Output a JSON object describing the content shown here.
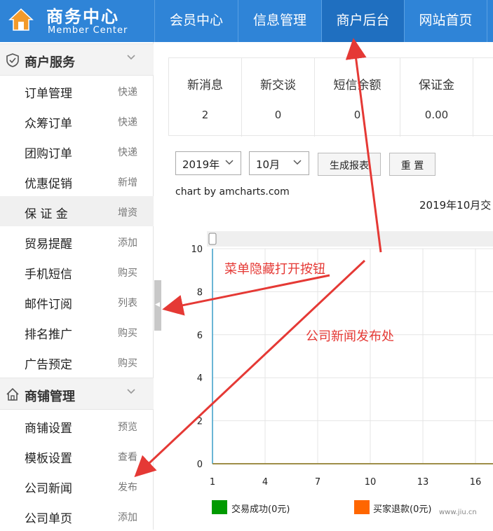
{
  "header": {
    "title": "商务中心",
    "subtitle": "Member Center",
    "nav": [
      {
        "label": "会员中心"
      },
      {
        "label": "信息管理"
      },
      {
        "label": "商户后台"
      },
      {
        "label": "网站首页"
      }
    ],
    "active_nav": "商户后台",
    "bg_color": "#2f84d7"
  },
  "sidebar": {
    "groups": [
      {
        "label": "商户服务",
        "icon": "shield-icon",
        "items": [
          {
            "label": "订单管理",
            "action": "快递"
          },
          {
            "label": "众筹订单",
            "action": "快递"
          },
          {
            "label": "团购订单",
            "action": "快递"
          },
          {
            "label": "优惠促销",
            "action": "新增"
          },
          {
            "label": "保 证 金",
            "action": "增资"
          },
          {
            "label": "贸易提醒",
            "action": "添加"
          },
          {
            "label": "手机短信",
            "action": "购买"
          },
          {
            "label": "邮件订阅",
            "action": "列表"
          },
          {
            "label": "排名推广",
            "action": "购买"
          },
          {
            "label": "广告预定",
            "action": "购买"
          }
        ]
      },
      {
        "label": "商铺管理",
        "icon": "house-icon",
        "items": [
          {
            "label": "商铺设置",
            "action": "预览"
          },
          {
            "label": "模板设置",
            "action": "查看"
          },
          {
            "label": "公司新闻",
            "action": "发布"
          },
          {
            "label": "公司单页",
            "action": "添加"
          }
        ]
      }
    ],
    "selected_item": "保 证 金"
  },
  "stats": [
    {
      "label": "新消息",
      "value": "2"
    },
    {
      "label": "新交谈",
      "value": "0"
    },
    {
      "label": "短信余额",
      "value": "0"
    },
    {
      "label": "保证金",
      "value": "0.00"
    }
  ],
  "filters": {
    "year": "2019年",
    "month": "10月",
    "generate_label": "生成报表",
    "reset_label": "重 置"
  },
  "chart_credit": "chart by amcharts.com",
  "chart_data": {
    "type": "line",
    "title": "2019年10月交",
    "x_ticks": [
      1,
      4,
      7,
      10,
      13,
      16
    ],
    "y_ticks": [
      0,
      2,
      4,
      6,
      8,
      10
    ],
    "xlim": [
      1,
      17
    ],
    "ylim": [
      0,
      10
    ],
    "grid": true,
    "series": [
      {
        "name": "交易成功(0元)",
        "color": "#009a00",
        "values": [
          0,
          0,
          0,
          0,
          0,
          0,
          0,
          0,
          0,
          0,
          0,
          0,
          0,
          0,
          0,
          0,
          0
        ]
      },
      {
        "name": "买家退款(0元)",
        "color": "#ff6600",
        "values": [
          0,
          0,
          0,
          0,
          0,
          0,
          0,
          0,
          0,
          0,
          0,
          0,
          0,
          0,
          0,
          0,
          0
        ]
      }
    ],
    "legend": "bottom"
  },
  "annotations": {
    "toggle_note": "菜单隐藏打开按钮",
    "news_note": "公司新闻发布处",
    "color": "#e53935"
  },
  "watermark": "www.jiu.cn"
}
